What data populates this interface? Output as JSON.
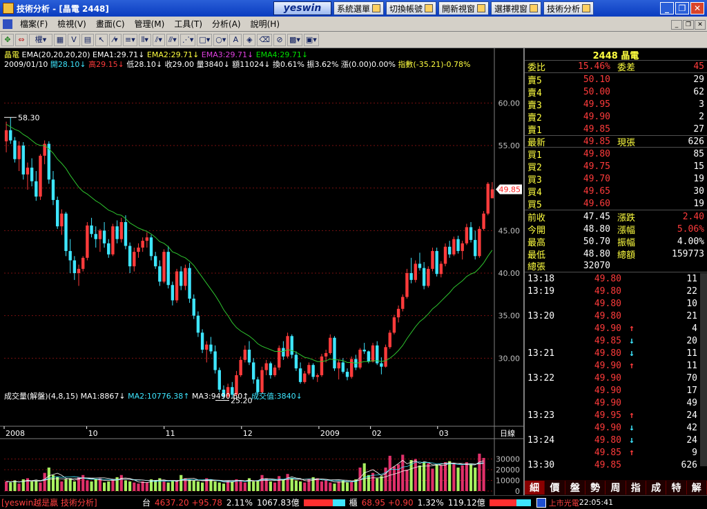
{
  "window": {
    "title": "技術分析 - [晶電 2448]",
    "logo": "yeswin"
  },
  "top_buttons": [
    "系統選單",
    "切換帳號",
    "開新視窗",
    "選擇視窗",
    "技術分析"
  ],
  "menu": [
    "檔案(F)",
    "檢視(V)",
    "畫面(C)",
    "管理(M)",
    "工具(T)",
    "分析(A)",
    "說明(H)"
  ],
  "toolbar": {
    "weight_label": "權"
  },
  "price_panel": {
    "stock_name": "晶電",
    "ema_text": "EMA(20,20,20,20) EMA1:29.71",
    "ema2_text": "EMA2:29.71",
    "ema3_text": "EMA3:29.71",
    "ema4_text": "EMA4:29.71",
    "arrow": "↓",
    "date": "2009/01/10",
    "open_label": "開28.10",
    "high_label": "高29.15",
    "low_label": "低28.10",
    "close_label": "收29.00",
    "volume_label": "量3840",
    "amount_label": "額11024",
    "turnover_label": "換0.61%",
    "amplitude_label": "振3.62%",
    "change_label": "漲(0.00)0.00%",
    "index_label": "指數(-35.21)-0.78%",
    "max_marker": "58.30",
    "min_marker": "25.20",
    "current_price_tag": "49.85",
    "y_ticks": [
      "60.00",
      "55.00",
      "50.00",
      "45.00",
      "40.00",
      "35.00",
      "30.00"
    ],
    "x_labels": [
      "2008",
      "10",
      "11",
      "12",
      "2009",
      "02",
      "03"
    ],
    "x_unit": "日線"
  },
  "volume_panel": {
    "label": "成交量(解盤)(4,8,15) MA1:8867",
    "ma2": "MA2:10776.38",
    "ma3": "MA3:9490.60",
    "vol_value": "成交值:3840",
    "y_ticks": [
      "30000",
      "20000",
      "10000",
      "0"
    ]
  },
  "chart_data": {
    "type": "candlestick",
    "title": "晶電 2448",
    "candles_ohlc": [
      [
        55.5,
        57.8,
        54.2,
        56.8
      ],
      [
        56.8,
        58.3,
        55.2,
        55.6
      ],
      [
        55.6,
        56.0,
        53.0,
        53.4
      ],
      [
        53.4,
        55.5,
        52.0,
        55.0
      ],
      [
        55.0,
        55.4,
        51.0,
        51.6
      ],
      [
        51.6,
        53.0,
        49.8,
        52.4
      ],
      [
        52.4,
        53.5,
        50.2,
        50.8
      ],
      [
        50.8,
        52.0,
        48.5,
        49.0
      ],
      [
        49.0,
        54.0,
        48.6,
        53.8
      ],
      [
        53.8,
        55.6,
        52.8,
        55.2
      ],
      [
        55.2,
        55.5,
        50.5,
        51.0
      ],
      [
        51.0,
        52.0,
        48.0,
        48.6
      ],
      [
        48.6,
        49.0,
        45.2,
        45.5
      ],
      [
        45.5,
        47.5,
        44.5,
        47.0
      ],
      [
        47.0,
        47.2,
        42.0,
        42.6
      ],
      [
        42.6,
        44.0,
        40.0,
        41.5
      ],
      [
        41.5,
        42.0,
        39.2,
        40.0
      ],
      [
        40.0,
        41.0,
        38.5,
        40.5
      ],
      [
        40.5,
        42.0,
        40.2,
        41.8
      ],
      [
        41.8,
        46.0,
        41.5,
        45.6
      ],
      [
        45.6,
        46.5,
        44.2,
        44.6
      ],
      [
        44.6,
        45.5,
        43.0,
        44.0
      ],
      [
        44.0,
        45.2,
        42.5,
        45.0
      ],
      [
        45.0,
        46.0,
        43.0,
        43.5
      ],
      [
        43.5,
        44.0,
        41.8,
        42.2
      ],
      [
        42.2,
        45.8,
        42.0,
        45.5
      ],
      [
        45.5,
        46.2,
        43.5,
        44.0
      ],
      [
        44.0,
        46.5,
        43.6,
        46.0
      ],
      [
        46.0,
        46.8,
        42.8,
        43.2
      ],
      [
        43.2,
        43.6,
        40.0,
        40.8
      ],
      [
        40.8,
        43.0,
        40.2,
        42.5
      ],
      [
        42.5,
        43.5,
        41.8,
        43.0
      ],
      [
        43.0,
        44.2,
        42.5,
        43.8
      ],
      [
        43.8,
        44.8,
        43.0,
        44.2
      ],
      [
        44.2,
        44.5,
        41.5,
        42.0
      ],
      [
        42.0,
        42.5,
        40.5,
        40.8
      ],
      [
        40.8,
        41.5,
        38.5,
        39.0
      ],
      [
        39.0,
        42.8,
        38.8,
        42.5
      ],
      [
        42.5,
        43.2,
        38.2,
        38.6
      ],
      [
        38.6,
        39.0,
        36.2,
        36.8
      ],
      [
        36.8,
        40.5,
        36.5,
        40.2
      ],
      [
        40.2,
        40.8,
        38.0,
        38.5
      ],
      [
        38.5,
        41.0,
        38.0,
        40.6
      ],
      [
        40.6,
        41.2,
        36.5,
        37.0
      ],
      [
        37.0,
        37.5,
        34.6,
        35.0
      ],
      [
        35.0,
        35.5,
        32.5,
        33.0
      ],
      [
        33.0,
        33.4,
        30.6,
        31.0
      ],
      [
        31.0,
        32.0,
        29.5,
        31.6
      ],
      [
        31.6,
        32.5,
        30.5,
        30.8
      ],
      [
        30.8,
        31.5,
        28.2,
        28.6
      ],
      [
        28.6,
        28.9,
        26.0,
        26.3
      ],
      [
        26.3,
        26.8,
        25.2,
        25.5
      ],
      [
        25.5,
        27.0,
        25.2,
        26.6
      ],
      [
        26.6,
        27.2,
        25.4,
        25.7
      ],
      [
        25.7,
        28.5,
        25.5,
        28.0
      ],
      [
        28.0,
        30.2,
        27.8,
        29.8
      ],
      [
        29.8,
        31.5,
        29.5,
        31.0
      ],
      [
        31.0,
        32.0,
        29.2,
        29.5
      ],
      [
        29.5,
        30.0,
        27.0,
        27.5
      ],
      [
        27.5,
        27.8,
        25.6,
        26.0
      ],
      [
        26.0,
        29.0,
        25.8,
        28.6
      ],
      [
        28.6,
        29.8,
        28.0,
        29.4
      ],
      [
        29.4,
        29.6,
        27.6,
        28.0
      ],
      [
        28.0,
        29.2,
        27.8,
        28.9
      ],
      [
        28.9,
        31.5,
        28.6,
        31.2
      ],
      [
        31.2,
        32.0,
        29.8,
        30.2
      ],
      [
        30.2,
        33.0,
        30.0,
        32.6
      ],
      [
        32.6,
        32.8,
        30.0,
        30.4
      ],
      [
        30.4,
        30.8,
        28.5,
        28.8
      ],
      [
        28.8,
        29.5,
        27.0,
        27.2
      ],
      [
        27.2,
        28.5,
        27.0,
        28.2
      ],
      [
        28.2,
        29.5,
        28.0,
        29.2
      ],
      [
        29.2,
        29.4,
        27.5,
        27.8
      ],
      [
        27.8,
        28.2,
        27.2,
        28.0
      ],
      [
        28.0,
        30.5,
        27.8,
        30.2
      ],
      [
        30.2,
        31.0,
        29.5,
        30.6
      ],
      [
        30.6,
        32.8,
        30.4,
        32.4
      ],
      [
        32.4,
        32.6,
        28.5,
        28.8
      ],
      [
        28.8,
        29.8,
        27.5,
        29.5
      ],
      [
        29.5,
        30.0,
        28.2,
        28.4
      ],
      [
        28.4,
        28.8,
        27.4,
        27.8
      ],
      [
        27.8,
        30.2,
        27.6,
        29.9
      ],
      [
        29.9,
        30.4,
        28.6,
        28.9
      ],
      [
        28.9,
        31.2,
        28.7,
        31.0
      ],
      [
        31.0,
        31.8,
        30.5,
        30.8
      ],
      [
        30.8,
        30.9,
        29.4,
        29.6
      ],
      [
        29.6,
        31.8,
        29.5,
        31.5
      ],
      [
        31.5,
        32.0,
        29.2,
        29.4
      ],
      [
        29.4,
        30.1,
        28.1,
        29.0
      ],
      [
        29.0,
        31.6,
        28.9,
        31.3
      ],
      [
        31.3,
        33.3,
        31.1,
        33.0
      ],
      [
        33.0,
        35.1,
        32.8,
        34.8
      ],
      [
        34.8,
        36.2,
        34.2,
        35.8
      ],
      [
        35.8,
        37.5,
        35.5,
        37.2
      ],
      [
        37.2,
        40.5,
        37.0,
        40.0
      ],
      [
        40.0,
        41.8,
        38.8,
        39.2
      ],
      [
        39.2,
        41.5,
        38.9,
        41.1
      ],
      [
        41.1,
        42.4,
        40.3,
        40.6
      ],
      [
        40.6,
        41.3,
        38.1,
        38.5
      ],
      [
        38.5,
        40.8,
        38.3,
        40.5
      ],
      [
        40.5,
        43.0,
        40.2,
        42.6
      ],
      [
        42.6,
        43.0,
        39.6,
        39.9
      ],
      [
        39.9,
        41.4,
        39.5,
        41.1
      ],
      [
        41.1,
        43.5,
        40.8,
        43.1
      ],
      [
        43.1,
        43.8,
        41.8,
        42.2
      ],
      [
        42.2,
        44.3,
        42.0,
        44.0
      ],
      [
        44.0,
        44.4,
        42.3,
        42.6
      ],
      [
        42.6,
        43.8,
        41.6,
        43.5
      ],
      [
        43.5,
        45.8,
        43.3,
        45.4
      ],
      [
        45.4,
        46.0,
        43.6,
        43.9
      ],
      [
        43.9,
        45.0,
        41.6,
        42.0
      ],
      [
        42.0,
        45.5,
        41.8,
        45.2
      ],
      [
        45.2,
        47.3,
        45.0,
        47.0
      ],
      [
        47.0,
        50.7,
        46.8,
        50.5
      ],
      [
        48.8,
        50.7,
        48.8,
        49.85
      ]
    ],
    "series": [
      {
        "name": "EMA",
        "values": [
          57.5,
          57.2,
          56.9,
          56.7,
          56.3,
          56.0,
          55.6,
          55.2,
          55.0,
          55.0,
          54.6,
          54.1,
          53.4,
          52.9,
          52.3,
          51.5,
          50.8,
          50.1,
          49.6,
          49.3,
          48.9,
          48.5,
          48.2,
          47.8,
          47.4,
          47.2,
          46.9,
          46.8,
          46.4,
          45.9,
          45.6,
          45.3,
          45.1,
          44.9,
          44.6,
          44.2,
          43.7,
          43.5,
          43.1,
          42.5,
          42.3,
          42.0,
          41.8,
          41.4,
          40.9,
          40.2,
          39.5,
          38.8,
          38.1,
          37.4,
          36.6,
          35.7,
          35.0,
          34.2,
          33.6,
          33.2,
          32.9,
          32.6,
          32.2,
          31.7,
          31.4,
          31.2,
          31.0,
          30.8,
          30.8,
          30.8,
          31.0,
          30.9,
          30.7,
          30.4,
          30.1,
          30.0,
          29.8,
          29.6,
          29.6,
          29.7,
          29.9,
          29.8,
          29.8,
          29.7,
          29.5,
          29.5,
          29.4,
          29.5,
          29.6,
          29.6,
          29.7,
          29.7,
          29.6,
          29.7,
          30.0,
          30.4,
          30.9,
          31.5,
          32.3,
          33.0,
          33.7,
          34.3,
          34.7,
          35.2,
          35.8,
          36.2,
          36.7,
          37.2,
          37.7,
          38.3,
          38.7,
          39.1,
          39.6,
          39.9,
          40.1,
          40.6,
          41.2,
          42.0,
          42.7
        ]
      }
    ],
    "volume": [
      9000,
      8000,
      10000,
      7000,
      11000,
      12000,
      9000,
      10000,
      8000,
      17000,
      22000,
      15000,
      13000,
      9000,
      11000,
      12000,
      9000,
      13000,
      15000,
      10000,
      9000,
      11000,
      12000,
      8000,
      9000,
      11000,
      13000,
      15000,
      10000,
      9000,
      8000,
      7000,
      9000,
      8000,
      11000,
      10000,
      12000,
      9000,
      8000,
      10000,
      9000,
      15000,
      12000,
      11000,
      10000,
      9000,
      8000,
      12000,
      10000,
      9000,
      8000,
      7000,
      10000,
      9000,
      11000,
      10000,
      8000,
      12000,
      9000,
      10000,
      15000,
      12000,
      9000,
      8000,
      14000,
      11000,
      16000,
      12000,
      10000,
      9000,
      8000,
      11000,
      13000,
      12000,
      9000,
      10000,
      8000,
      7000,
      9000,
      10000,
      8000,
      9000,
      11000,
      22000,
      26000,
      15000,
      17000,
      12000,
      14000,
      22000,
      33000,
      23000,
      25000,
      34000,
      20000,
      29000,
      30000,
      24000,
      27000,
      26000,
      21000,
      25000,
      24000,
      27000,
      28000,
      26000,
      22000,
      24000,
      27000,
      25000,
      22000,
      35000,
      31000
    ]
  },
  "quote": {
    "title": "2448 晶電",
    "ratio_label": "委比",
    "ratio_value": "15.46%",
    "diff_label": "委差",
    "diff_value": "45",
    "asks": [
      {
        "label": "賣5",
        "price": "50.10",
        "qty": "29"
      },
      {
        "label": "賣4",
        "price": "50.00",
        "qty": "62"
      },
      {
        "label": "賣3",
        "price": "49.95",
        "qty": "3"
      },
      {
        "label": "賣2",
        "price": "49.90",
        "qty": "2"
      },
      {
        "label": "賣1",
        "price": "49.85",
        "qty": "27"
      }
    ],
    "last_label": "最新",
    "last_price": "49.85",
    "cur_vol_label": "現張",
    "cur_vol": "626",
    "bids": [
      {
        "label": "買1",
        "price": "49.80",
        "qty": "85"
      },
      {
        "label": "買2",
        "price": "49.75",
        "qty": "15"
      },
      {
        "label": "買3",
        "price": "49.70",
        "qty": "19"
      },
      {
        "label": "買4",
        "price": "49.65",
        "qty": "30"
      },
      {
        "label": "買5",
        "price": "49.60",
        "qty": "19"
      }
    ],
    "stats": [
      {
        "l1": "前收",
        "v1": "47.45",
        "l2": "漲跌",
        "v2": "2.40"
      },
      {
        "l1": "今開",
        "v1": "48.80",
        "l2": "漲幅",
        "v2": "5.06%"
      },
      {
        "l1": "最高",
        "v1": "50.70",
        "l2": "振幅",
        "v2": "4.00%"
      },
      {
        "l1": "最低",
        "v1": "48.80",
        "l2": "總額",
        "v2": "159773"
      }
    ],
    "total_label": "總張",
    "total_value": "32070"
  },
  "ticks": [
    {
      "time": "13:18",
      "price": "49.80",
      "arrow": "",
      "qty": "11"
    },
    {
      "time": "13:19",
      "price": "49.80",
      "arrow": "",
      "qty": "22"
    },
    {
      "time": "",
      "price": "49.80",
      "arrow": "",
      "qty": "10"
    },
    {
      "time": "13:20",
      "price": "49.80",
      "arrow": "",
      "qty": "21"
    },
    {
      "time": "",
      "price": "49.90",
      "arrow": "↑",
      "qty": "4"
    },
    {
      "time": "",
      "price": "49.85",
      "arrow": "↓",
      "qty": "20"
    },
    {
      "time": "13:21",
      "price": "49.80",
      "arrow": "↓",
      "qty": "11"
    },
    {
      "time": "",
      "price": "49.90",
      "arrow": "↑",
      "qty": "11"
    },
    {
      "time": "13:22",
      "price": "49.90",
      "arrow": "",
      "qty": "70"
    },
    {
      "time": "",
      "price": "49.90",
      "arrow": "",
      "qty": "17"
    },
    {
      "time": "",
      "price": "49.90",
      "arrow": "",
      "qty": "49"
    },
    {
      "time": "13:23",
      "price": "49.95",
      "arrow": "↑",
      "qty": "24"
    },
    {
      "time": "",
      "price": "49.90",
      "arrow": "↓",
      "qty": "42"
    },
    {
      "time": "13:24",
      "price": "49.80",
      "arrow": "↓",
      "qty": "24"
    },
    {
      "time": "",
      "price": "49.85",
      "arrow": "↑",
      "qty": "9"
    },
    {
      "time": "13:30",
      "price": "49.85",
      "arrow": "",
      "qty": "626"
    }
  ],
  "detail_tabs": [
    "細",
    "價",
    "盤",
    "勢",
    "周",
    "指",
    "成",
    "特",
    "解"
  ],
  "status": {
    "brand": "[yeswin越是贏 技術分析]",
    "tai_label": "台",
    "tai_value": "4637.20 +95.78",
    "tai_pct": "2.11%",
    "tai_amount": "1067.83億",
    "otc_label": "櫃",
    "otc_value": "68.95 +0.90",
    "otc_pct": "1.32%",
    "otc_amount": "119.12億",
    "news": "上市光電",
    "time": "22:05:41"
  },
  "colors": {
    "up": "#ff3b3b",
    "down": "#3ee6ff",
    "ema": "#2ec42e",
    "grid": "#7a1010",
    "volume_up": "#e0306a",
    "volume_down": "#a8f060"
  }
}
